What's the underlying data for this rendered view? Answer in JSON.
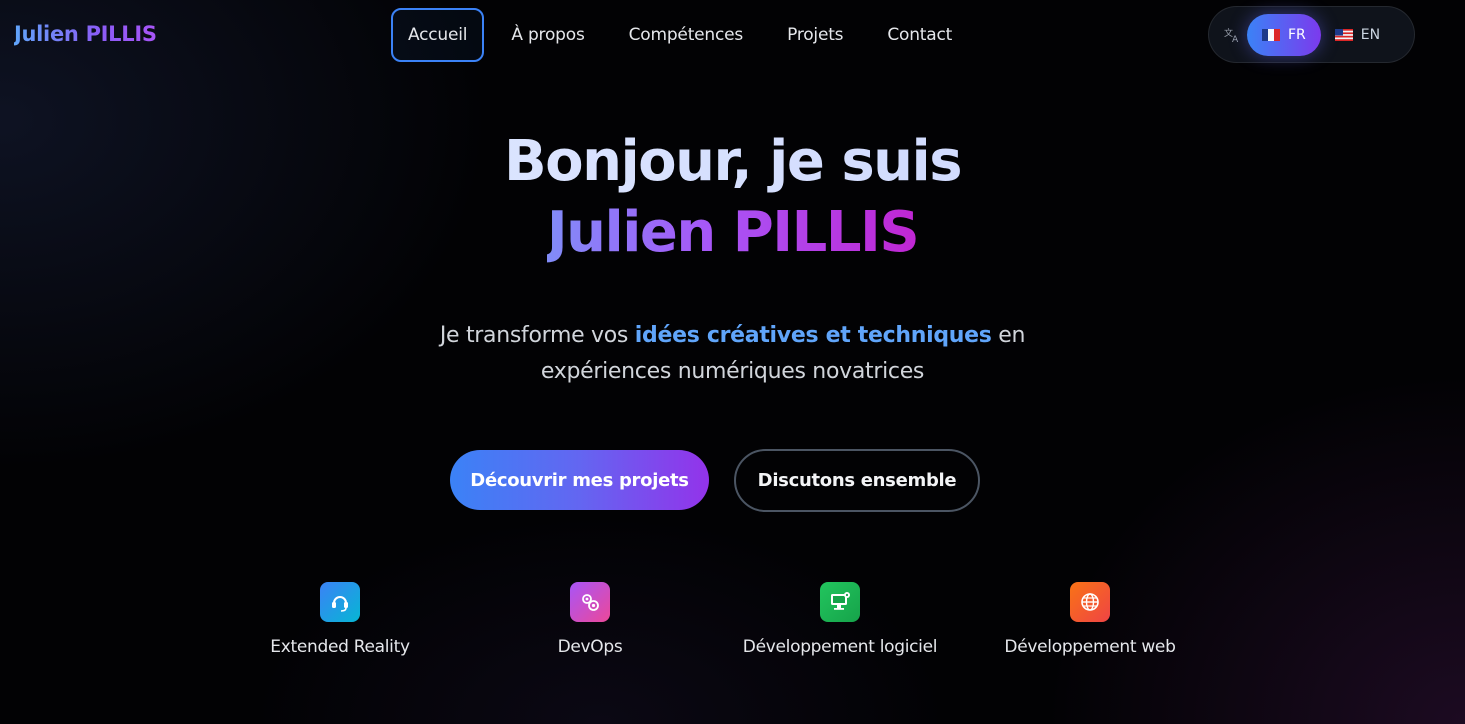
{
  "brand": {
    "name": "Julien PILLIS"
  },
  "nav": {
    "items": [
      {
        "label": "Accueil",
        "active": true
      },
      {
        "label": "À propos",
        "active": false
      },
      {
        "label": "Compétences",
        "active": false
      },
      {
        "label": "Projets",
        "active": false
      },
      {
        "label": "Contact",
        "active": false
      }
    ]
  },
  "language": {
    "icon": "translate-icon",
    "options": [
      {
        "code": "FR",
        "flag": "flag-france-icon",
        "active": true
      },
      {
        "code": "EN",
        "flag": "flag-usa-icon",
        "active": false
      }
    ]
  },
  "hero": {
    "greeting": "Bonjour, je suis",
    "name": "Julien PILLIS",
    "tagline_before": "Je transforme vos ",
    "tagline_highlight": "idées créatives et techniques",
    "tagline_after": " en",
    "tagline_line2": "expériences numériques novatrices",
    "primary_cta": "Découvrir mes projets",
    "secondary_cta": "Discutons ensemble"
  },
  "skills": [
    {
      "label": "Extended Reality",
      "icon": "headset-icon",
      "color_from": "#3b82f6",
      "color_to": "#06b6d4"
    },
    {
      "label": "DevOps",
      "icon": "gears-icon",
      "color_from": "#a855f7",
      "color_to": "#ec4899"
    },
    {
      "label": "Développement logiciel",
      "icon": "monitor-code-icon",
      "color_from": "#22c55e",
      "color_to": "#16a34a"
    },
    {
      "label": "Développement web",
      "icon": "globe-icon",
      "color_from": "#f97316",
      "color_to": "#ef4444"
    }
  ],
  "colors": {
    "accent_blue": "#3b82f6",
    "accent_purple": "#9333ea",
    "highlight_text": "#60a5fa",
    "background": "#020204"
  }
}
